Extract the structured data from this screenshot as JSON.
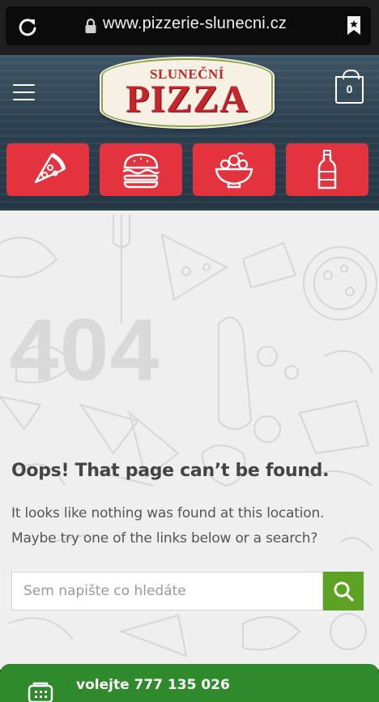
{
  "browser": {
    "url": "www.pizzerie-slunecni.cz"
  },
  "header": {
    "logo_top": "SLUNEČNÍ",
    "logo_main": "PIZZA",
    "cart_count": "0",
    "categories": [
      {
        "icon": "pizza-slice-icon"
      },
      {
        "icon": "burger-icon"
      },
      {
        "icon": "salad-bowl-icon"
      },
      {
        "icon": "bottle-icon"
      }
    ]
  },
  "error": {
    "code": "404",
    "title": "Oops! That page can’t be found.",
    "message": "It looks like nothing was found at this location. Maybe try one of the links below or a search?"
  },
  "search": {
    "placeholder": "Sem napište co hledáte"
  },
  "callbar": {
    "text": "volejte 777 135 026"
  },
  "colors": {
    "category_red": "#e2333f",
    "search_green": "#5ea223",
    "callbar_green": "#2e8a2b",
    "logo_red": "#c3272b"
  }
}
